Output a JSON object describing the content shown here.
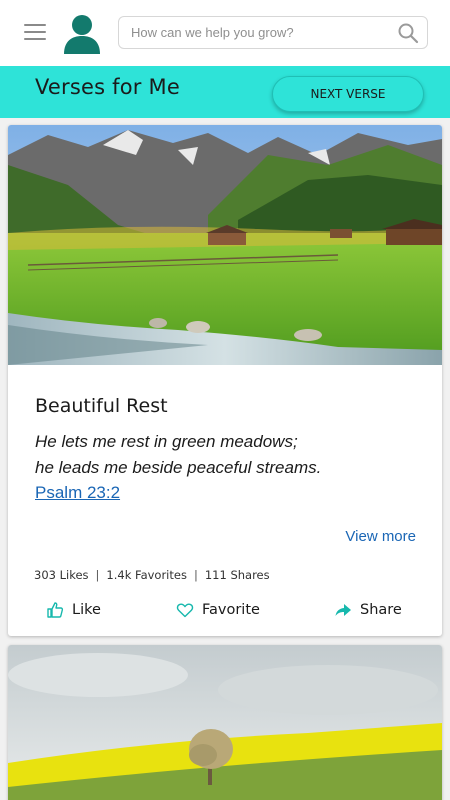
{
  "header": {
    "search_placeholder": "How can we help you grow?"
  },
  "band": {
    "title": "Verses for Me",
    "next_label": "NEXT VERSE"
  },
  "card": {
    "title": "Beautiful Rest",
    "verse_lines": [
      "He lets me rest in green meadows;",
      "he leads me beside peaceful streams."
    ],
    "reference": "Psalm 23:2",
    "view_more": "View more",
    "stats": {
      "likes": "303 Likes",
      "favorites": "1.4k Favorites",
      "shares": "111 Shares"
    },
    "actions": {
      "like": "Like",
      "favorite": "Favorite",
      "share": "Share"
    }
  },
  "colors": {
    "accent": "#2ee3d8",
    "avatar": "#137a6d",
    "link": "#1a66b5"
  }
}
